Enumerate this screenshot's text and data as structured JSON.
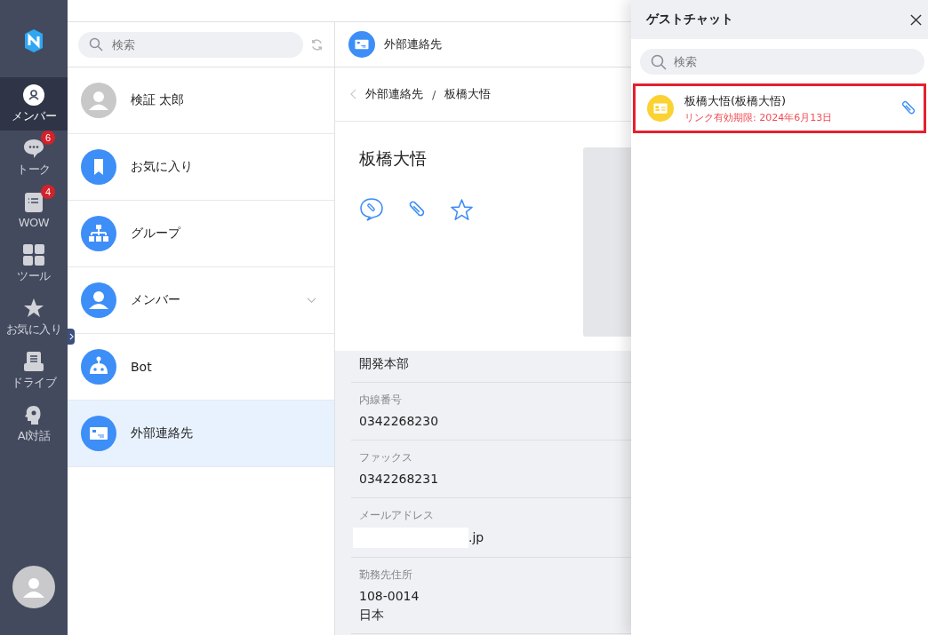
{
  "nav": {
    "items": [
      {
        "label": "メンバー",
        "selected": true
      },
      {
        "label": "トーク",
        "selected": false,
        "badge": "6"
      },
      {
        "label": "WOW",
        "selected": false,
        "badge": "4"
      },
      {
        "label": "ツール",
        "selected": false
      },
      {
        "label": "お気に入り",
        "selected": false
      },
      {
        "label": "ドライブ",
        "selected": false
      },
      {
        "label": "AI対話",
        "selected": false
      }
    ]
  },
  "list": {
    "search": {
      "placeholder": "検索"
    },
    "items": [
      {
        "label": "検証 太郎",
        "selected": false,
        "expandable": false
      },
      {
        "label": "お気に入り",
        "selected": false,
        "expandable": false
      },
      {
        "label": "グループ",
        "selected": false,
        "expandable": false
      },
      {
        "label": "メンバー",
        "selected": false,
        "expandable": true
      },
      {
        "label": "Bot",
        "selected": false,
        "expandable": false
      },
      {
        "label": "外部連絡先",
        "selected": true,
        "expandable": false
      }
    ]
  },
  "detail": {
    "header": "外部連絡先",
    "breadcrumb": [
      "外部連絡先",
      "板橋大悟"
    ],
    "breadcrumb_separator": "/",
    "name": "板橋大悟",
    "fields": [
      {
        "values": [
          "開発本部"
        ]
      },
      {
        "label": "内線番号",
        "values": [
          "0342268230"
        ]
      },
      {
        "label": "ファックス",
        "values": [
          "0342268231"
        ]
      },
      {
        "label": "メールアドレス",
        "values": [
          ".jp"
        ],
        "redacted": true
      },
      {
        "label": "勤務先住所",
        "values": [
          "108-0014",
          "日本"
        ]
      }
    ]
  },
  "guest_chat": {
    "title": "ゲストチャット",
    "search": {
      "placeholder": "検索"
    },
    "items": [
      {
        "name": "板橋大悟(板橋大悟)",
        "expiry": "リンク有効期限: 2024年6月13日",
        "highlighted": true
      }
    ]
  }
}
